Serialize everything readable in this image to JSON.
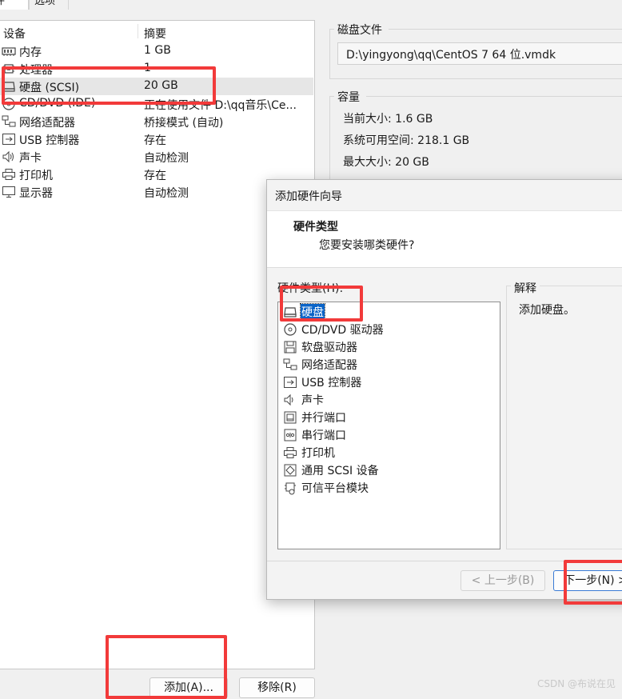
{
  "tabs": [
    {
      "label": "件"
    },
    {
      "label": "选项"
    }
  ],
  "device_table": {
    "headers": {
      "device": "设备",
      "summary": "摘要"
    },
    "rows": [
      {
        "name": "内存",
        "summary": "1 GB",
        "icon": "memory-icon"
      },
      {
        "name": "处理器",
        "summary": "1",
        "icon": "cpu-icon"
      },
      {
        "name": "硬盘 (SCSI)",
        "summary": "20 GB",
        "icon": "harddisk-icon"
      },
      {
        "name": "CD/DVD (IDE)",
        "summary": "正在使用文件 D:\\qq音乐\\Ce...",
        "icon": "cdrom-icon"
      },
      {
        "name": "网络适配器",
        "summary": "桥接模式 (自动)",
        "icon": "network-icon"
      },
      {
        "name": "USB 控制器",
        "summary": "存在",
        "icon": "usb-icon"
      },
      {
        "name": "声卡",
        "summary": "自动检测",
        "icon": "speaker-icon"
      },
      {
        "name": "打印机",
        "summary": "存在",
        "icon": "printer-icon"
      },
      {
        "name": "显示器",
        "summary": "自动检测",
        "icon": "monitor-icon"
      }
    ]
  },
  "disk_file": {
    "title": "磁盘文件",
    "path": "D:\\yingyong\\qq\\CentOS 7 64 位.vmdk"
  },
  "capacity": {
    "title": "容量",
    "current_size": "当前大小: 1.6 GB",
    "available": "系统可用空间: 218.1 GB",
    "max_size": "最大大小: 20 GB"
  },
  "bottom_buttons": {
    "add": "添加(A)...",
    "remove": "移除(R)"
  },
  "wizard": {
    "title": "添加硬件向导",
    "header_title": "硬件类型",
    "header_subtitle": "您要安装哪类硬件?",
    "list_label": "硬件类型(H):",
    "items": [
      {
        "label": "硬盘",
        "icon": "harddisk-icon",
        "selected": true
      },
      {
        "label": "CD/DVD 驱动器",
        "icon": "cdrom-icon",
        "selected": false
      },
      {
        "label": "软盘驱动器",
        "icon": "floppy-icon",
        "selected": false
      },
      {
        "label": "网络适配器",
        "icon": "network-icon",
        "selected": false
      },
      {
        "label": "USB 控制器",
        "icon": "usb-icon",
        "selected": false
      },
      {
        "label": "声卡",
        "icon": "speaker-icon",
        "selected": false
      },
      {
        "label": "并行端口",
        "icon": "parallel-port-icon",
        "selected": false
      },
      {
        "label": "串行端口",
        "icon": "serial-port-icon",
        "selected": false
      },
      {
        "label": "打印机",
        "icon": "printer-icon",
        "selected": false
      },
      {
        "label": "通用 SCSI 设备",
        "icon": "scsi-icon",
        "selected": false
      },
      {
        "label": "可信平台模块",
        "icon": "tpm-icon",
        "selected": false
      }
    ],
    "explain_title": "解释",
    "explain_text": "添加硬盘。",
    "back_button": "< 上一步(B)",
    "next_button": "下一步(N) >"
  },
  "watermark": "CSDN @布说在见",
  "colors": {
    "selection": "#0a64c8",
    "annotation_red": "#f23a3a",
    "row_selected": "#e6e6e6"
  }
}
